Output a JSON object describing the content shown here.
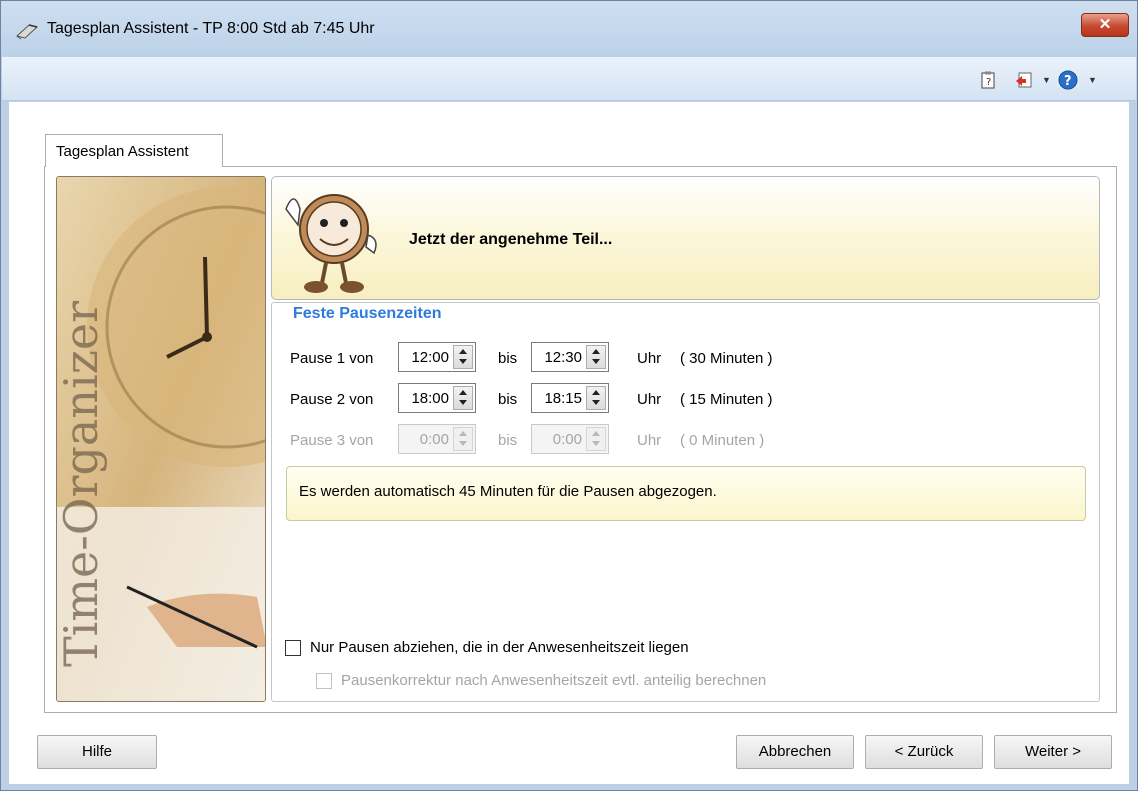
{
  "window": {
    "title": "Tagesplan Assistent - TP 8:00 Std ab 7:45 Uhr",
    "close_label": "✕"
  },
  "toolbar": {
    "icons": [
      "clipboard-icon",
      "exit-icon",
      "help-icon"
    ]
  },
  "tab": {
    "label": "Tagesplan Assistent"
  },
  "sidebar": {
    "image_text": "Time-Organizer"
  },
  "header": {
    "text": "Jetzt der angenehme Teil..."
  },
  "group": {
    "title": "Feste Pausenzeiten"
  },
  "pauses": [
    {
      "label": "Pause 1 von",
      "from": "12:00",
      "bis": "bis",
      "to": "12:30",
      "uhr": "Uhr",
      "duration": "( 30 Minuten )",
      "enabled": true
    },
    {
      "label": "Pause 2 von",
      "from": "18:00",
      "bis": "bis",
      "to": "18:15",
      "uhr": "Uhr",
      "duration": "( 15 Minuten )",
      "enabled": true
    },
    {
      "label": "Pause 3 von",
      "from": "0:00",
      "bis": "bis",
      "to": "0:00",
      "uhr": "Uhr",
      "duration": "( 0 Minuten )",
      "enabled": false
    }
  ],
  "info": {
    "text": "Es werden automatisch 45 Minuten für die Pausen abgezogen."
  },
  "checkboxes": [
    {
      "label": "Nur Pausen abziehen, die in der Anwesenheitszeit liegen",
      "checked": false,
      "enabled": true
    },
    {
      "label": "Pausenkorrektur nach Anwesenheitszeit evtl. anteilig berechnen",
      "checked": false,
      "enabled": false
    }
  ],
  "buttons": {
    "help": "Hilfe",
    "cancel": "Abbrechen",
    "back": "< Zurück",
    "next": "Weiter >"
  }
}
